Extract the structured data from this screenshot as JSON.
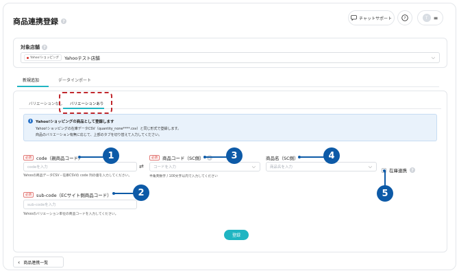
{
  "header": {
    "title": "商品連携登録",
    "chat_support": "チャットサポート",
    "help": "?",
    "avatar": "T",
    "menu_icon": "≡"
  },
  "store": {
    "label": "対象店舗",
    "badge": "Yahoo!ショッピング",
    "name": "Yahooテスト店舗"
  },
  "tabs": [
    "新規追加",
    "データインポート"
  ],
  "sub_tabs": [
    "バリエーションなし",
    "バリエーションあり"
  ],
  "info": {
    "title": "Yahoo!ショッピングの商品として登録します",
    "line1": "Yahoo!ショッピングの在庫データCSV（quantity_none****.csv）と同じ形式で登録します。",
    "line2": "商品のバリエーション有無に応じて、上部のタブを切り替えて入力してください。"
  },
  "required_label": "必須",
  "fields": {
    "code": {
      "label": "code（親商品コード）",
      "placeholder": "codeを入力",
      "help": "Yahooの商品データCSV・在庫CSVの code 列の値を入力してください。"
    },
    "sc_code": {
      "label": "商品コード（SC側）",
      "placeholder": "コードを入力",
      "help": "半角英数字 / 100文字以内で入力してください"
    },
    "sc_name": {
      "label": "商品名（SC側）",
      "placeholder": "商品名を入力"
    },
    "stock": {
      "label": "在庫連携"
    },
    "sub_code": {
      "label": "sub-code（ECサイト側商品コード）",
      "placeholder": "sub-codeを入力",
      "help": "Yahooのバリエーション単位の商品コードを入力してください。"
    }
  },
  "callouts": [
    "1",
    "2",
    "3",
    "4",
    "5"
  ],
  "buttons": {
    "register": "登録",
    "back": "商品連携一覧"
  },
  "colors": {
    "accent": "#20b5c2",
    "callout": "#0d5aa7",
    "highlight": "#c0262b",
    "info_bg": "#e9f2fb"
  }
}
